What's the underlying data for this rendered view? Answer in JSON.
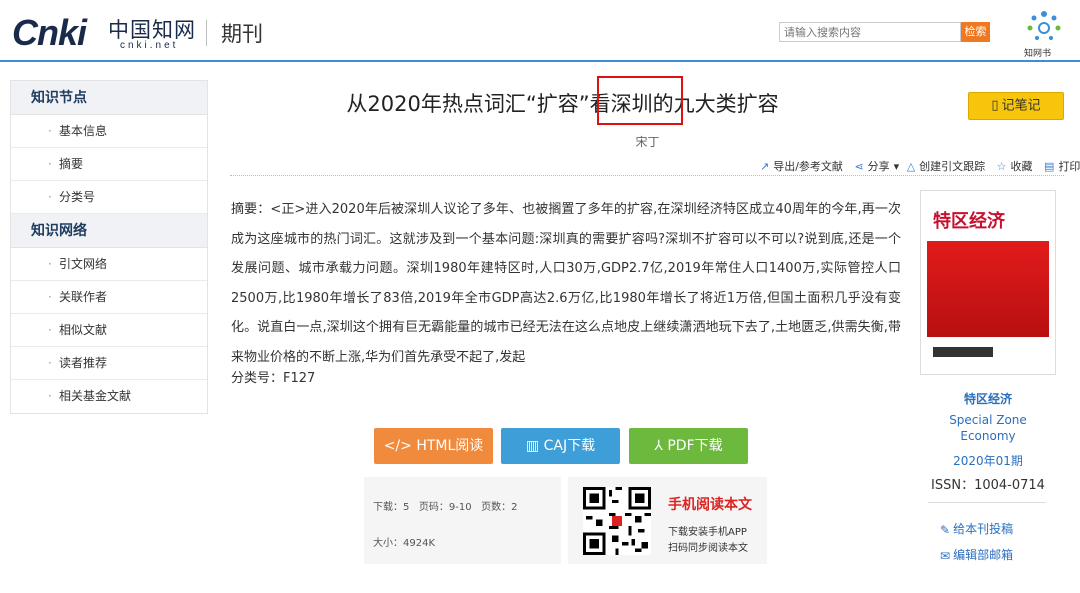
{
  "header": {
    "logo_text": "Cnki",
    "logo_cn": "中国知网",
    "logo_net": "cnki.net",
    "section": "期刊",
    "search_placeholder": "请输入搜索内容",
    "search_button": "检索",
    "brand_label": "知网书"
  },
  "sidebar": {
    "groups": [
      {
        "title": "知识节点",
        "items": [
          "基本信息",
          "摘要",
          "分类号"
        ]
      },
      {
        "title": "知识网络",
        "items": [
          "引文网络",
          "关联作者",
          "相似文献",
          "读者推荐",
          "相关基金文献"
        ]
      }
    ]
  },
  "article": {
    "title": "从2020年热点词汇“扩容”看深圳的九大类扩容",
    "note_button": "记笔记",
    "author": "宋丁",
    "toolbar": {
      "export": "导出/参考文献",
      "share": "分享",
      "track": "创建引文跟踪",
      "favorite": "收藏",
      "print": "打印"
    },
    "abstract_label": "摘要：",
    "abstract": "<正>进入2020年后被深圳人议论了多年、也被搁置了多年的扩容,在深圳经济特区成立40周年的今年,再一次成为这座城市的热门词汇。这就涉及到一个基本问题:深圳真的需要扩容吗?深圳不扩容可以不可以?说到底,还是一个发展问题、城市承载力问题。深圳1980年建特区时,人口30万,GDP2.7亿,2019年常住人口1400万,实际管控人口2500万,比1980年增长了83倍,2019年全市GDP高达2.6万亿,比1980年增长了将近1万倍,但国土面积几乎没有变化。说直白一点,深圳这个拥有巨无霸能量的城市已经无法在这么点地皮上继续潇洒地玩下去了,土地匮乏,供需失衡,带来物业价格的不断上涨,华为们首先承受不起了,发起",
    "class_label": "分类号：",
    "class_no": "F127"
  },
  "downloads": {
    "html": "HTML阅读",
    "caj": "CAJ下载",
    "pdf": "PDF下载"
  },
  "info": {
    "downloads_label": "下载：",
    "downloads": "5",
    "pages_label": "页码：",
    "pages": "9-10",
    "page_count_label": "页数：",
    "page_count": "2",
    "size_label": "大小：",
    "size": "4924K"
  },
  "mobile": {
    "title": "手机阅读本文",
    "line1": "下载安装手机APP",
    "line2": "扫码同步阅读本文"
  },
  "journal": {
    "cover_title": "特区经济",
    "name_cn": "特区经济",
    "name_en": "Special Zone Economy",
    "issue": "2020年01期",
    "issn": "ISSN：1004-0714",
    "submit": "给本刊投稿",
    "email": "编辑部邮箱"
  },
  "colors": {
    "accent_blue": "#3b8fd6",
    "search_orange": "#f07820",
    "html_btn": "#f08a3c",
    "caj_btn": "#3d9ed8",
    "pdf_btn": "#6cb93e",
    "note_btn": "#f6c50c",
    "highlight": "#dd1111"
  }
}
